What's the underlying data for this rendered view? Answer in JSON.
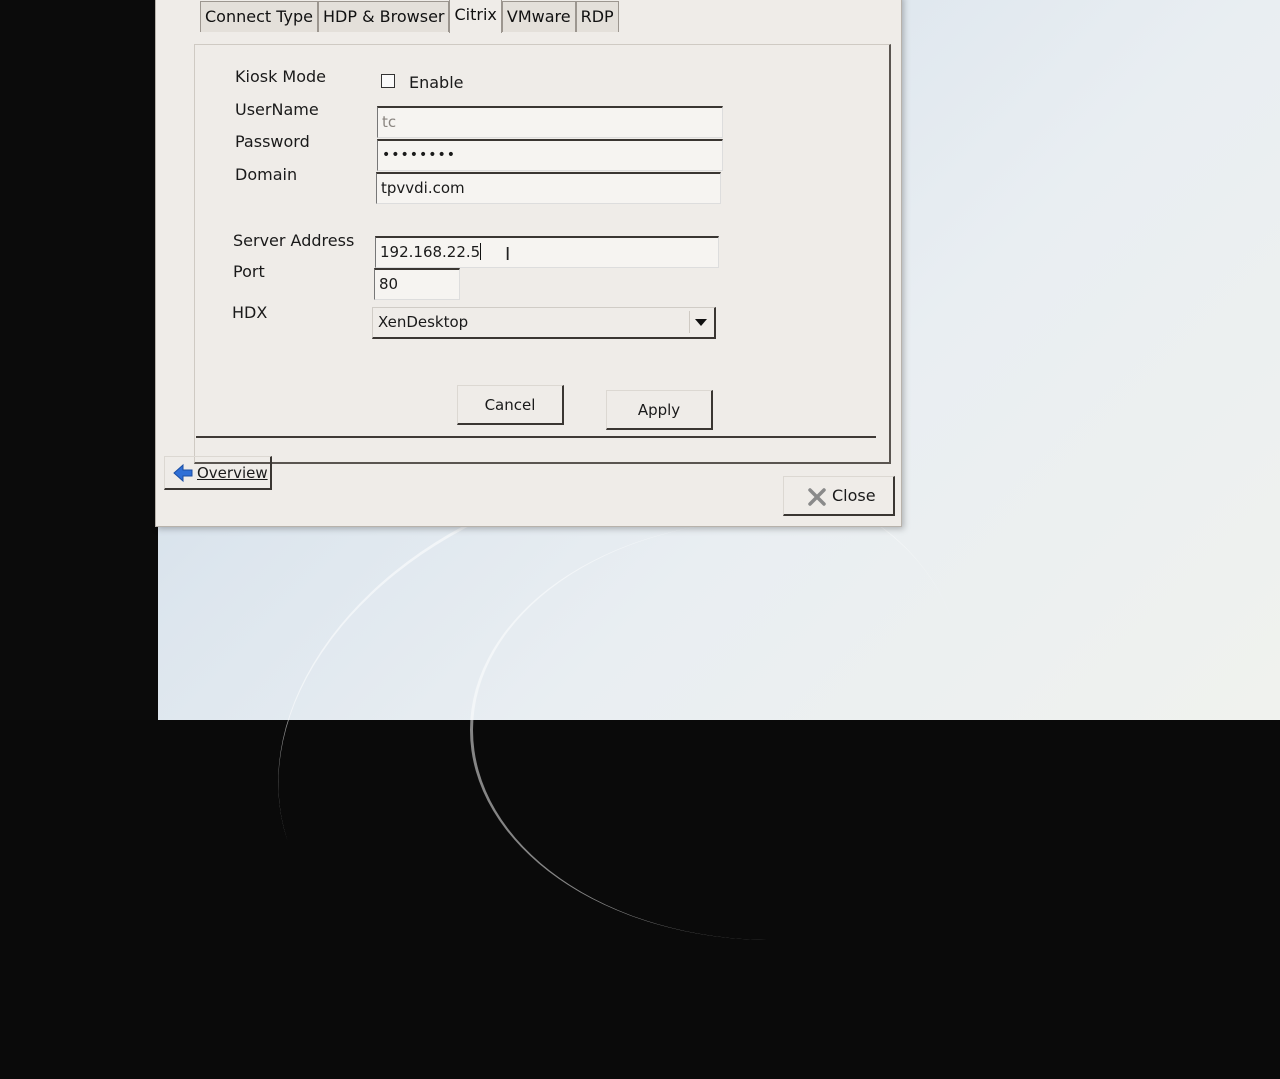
{
  "tabs": [
    {
      "label": "Connect Type",
      "active": false
    },
    {
      "label": "HDP & Browser",
      "active": false
    },
    {
      "label": "Citrix",
      "active": true
    },
    {
      "label": "VMware",
      "active": false
    },
    {
      "label": "RDP",
      "active": false
    }
  ],
  "form": {
    "kiosk_mode": {
      "label": "Kiosk Mode",
      "option_label": "Enable",
      "checked": false
    },
    "username": {
      "label": "UserName",
      "placeholder": "tc"
    },
    "password": {
      "label": "Password",
      "masked_value": "••••••••"
    },
    "domain": {
      "label": "Domain",
      "value": "tpvvdi.com"
    },
    "server_address": {
      "label": "Server Address",
      "value": "192.168.22.5"
    },
    "port": {
      "label": "Port",
      "value": "80"
    },
    "hdx": {
      "label": "HDX",
      "selected": "XenDesktop"
    }
  },
  "buttons": {
    "cancel": "Cancel",
    "apply": "Apply",
    "overview": "Overview",
    "close": "Close"
  },
  "colors": {
    "window_bg": "#efece8",
    "arrow_icon": "#2f6fd6",
    "close_icon": "#8a8a8a"
  }
}
